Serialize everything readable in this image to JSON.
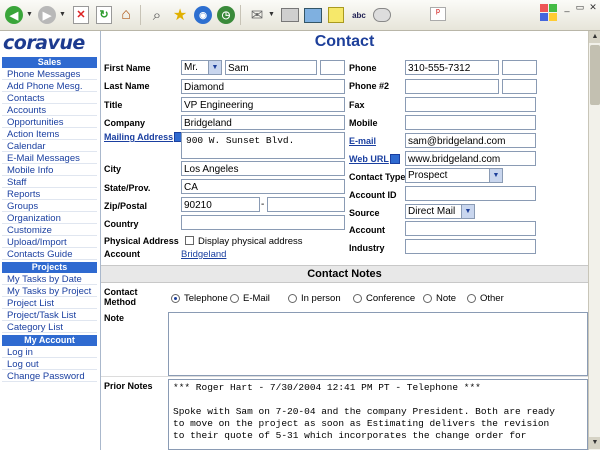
{
  "toolbar": {
    "icons": [
      "back-icon",
      "forward-icon",
      "stop-icon",
      "refresh-icon",
      "home-icon",
      "search-icon",
      "favorites-icon",
      "media-icon",
      "history-icon",
      "mail-icon",
      "print-icon",
      "edit-icon",
      "notes-icon",
      "spell-check-icon",
      "messenger-icon"
    ],
    "spell_label": "abc",
    "restore_btn": "▭",
    "min_btn": "_",
    "close_btn": "✕"
  },
  "nav": {
    "logo": "coravue",
    "sections": [
      {
        "title": "Sales",
        "items": [
          "Phone Messages",
          "Add Phone Mesg.",
          "Contacts",
          "Accounts",
          "Opportunities",
          "Action Items",
          "Calendar",
          "E-Mail Messages",
          "Mobile Info",
          "Staff",
          "Reports",
          "Groups",
          "Organization",
          "Customize",
          "Upload/Import",
          "Contacts Guide"
        ]
      },
      {
        "title": "Projects",
        "items": [
          "My Tasks by Date",
          "My Tasks by Project",
          "Project List",
          "Project/Task List",
          "Category List"
        ]
      },
      {
        "title": "My Account",
        "items": [
          "Log in",
          "Log out",
          "Change Password"
        ]
      }
    ]
  },
  "page": {
    "title": "Contact"
  },
  "form": {
    "first_name": {
      "label": "First Name",
      "prefix": "Mr.",
      "value": "Sam",
      "extra": ""
    },
    "last_name": {
      "label": "Last Name",
      "value": "Diamond"
    },
    "title": {
      "label": "Title",
      "value": "VP Engineering"
    },
    "company": {
      "label": "Company",
      "value": "Bridgeland"
    },
    "mailing_address": {
      "label": "Mailing Address",
      "value": "900 W. Sunset Blvd."
    },
    "city": {
      "label": "City",
      "value": "Los Angeles"
    },
    "state": {
      "label": "State/Prov.",
      "value": "CA"
    },
    "zip": {
      "label": "Zip/Postal",
      "value": "90210",
      "sep": "-",
      "ext": ""
    },
    "country": {
      "label": "Country",
      "value": ""
    },
    "physical_address": {
      "label": "Physical Address",
      "checkbox_label": "Display physical address"
    },
    "account": {
      "label": "Account",
      "value": "Bridgeland"
    },
    "phone": {
      "label": "Phone",
      "value": "310-555-7312",
      "ext": ""
    },
    "phone2": {
      "label": "Phone #2",
      "value": "",
      "ext": ""
    },
    "fax": {
      "label": "Fax",
      "value": ""
    },
    "mobile": {
      "label": "Mobile",
      "value": ""
    },
    "email": {
      "label": "E-mail",
      "value": "sam@bridgeland.com"
    },
    "web_url": {
      "label": "Web URL",
      "value": "www.bridgeland.com"
    },
    "contact_type": {
      "label": "Contact Type",
      "value": "Prospect"
    },
    "account_id": {
      "label": "Account ID",
      "value": ""
    },
    "source": {
      "label": "Source",
      "value": "Direct Mail"
    },
    "account2": {
      "label": "Account",
      "value": ""
    },
    "industry": {
      "label": "Industry",
      "value": ""
    }
  },
  "notes": {
    "section_title": "Contact Notes",
    "method_label_1": "Contact",
    "method_label_2": "Method",
    "methods": [
      "Telephone",
      "E-Mail",
      "In person",
      "Conference",
      "Note",
      "Other"
    ],
    "selected_method": "Telephone",
    "note_label": "Note",
    "note_value": "",
    "prior_label": "Prior Notes",
    "prior_lines": [
      "*** Roger Hart - 7/30/2004 12:41 PM PT - Telephone ***",
      "",
      "Spoke with Sam on 7-20-04 and the company President. Both are ready",
      "to move on the project as soon as Estimating delivers the revision",
      "to their quote of 5-31 which incorporates the change order for"
    ]
  },
  "scrollbar": {
    "up": "▲",
    "down": "▼"
  }
}
